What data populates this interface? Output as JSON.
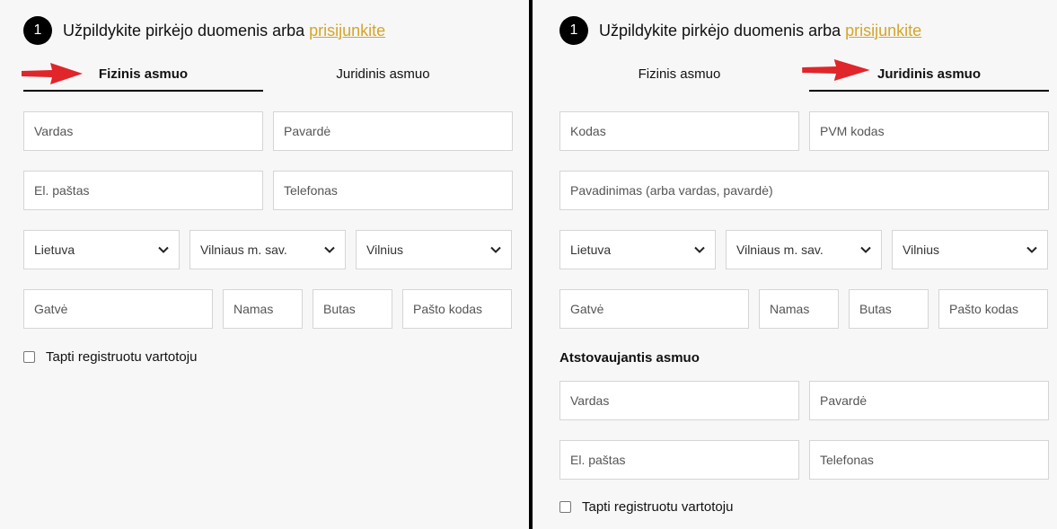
{
  "left": {
    "heading": {
      "step": "1",
      "text": "Užpildykite pirkėjo duomenis arba",
      "link": "prisijunkite"
    },
    "tabs": [
      {
        "label": "Fizinis asmuo",
        "active": true
      },
      {
        "label": "Juridinis asmuo",
        "active": false
      }
    ],
    "fields": {
      "first_name": "Vardas",
      "last_name": "Pavardė",
      "email": "El. paštas",
      "phone": "Telefonas",
      "country": "Lietuva",
      "municipality": "Vilniaus m. sav.",
      "city": "Vilnius",
      "street": "Gatvė",
      "house": "Namas",
      "apartment": "Butas",
      "postal_code": "Pašto kodas"
    },
    "register_label": "Tapti registruotu vartotoju"
  },
  "right": {
    "heading": {
      "step": "1",
      "text": "Užpildykite pirkėjo duomenis arba",
      "link": "prisijunkite"
    },
    "tabs": [
      {
        "label": "Fizinis asmuo",
        "active": false
      },
      {
        "label": "Juridinis asmuo",
        "active": true
      }
    ],
    "fields": {
      "company_code": "Kodas",
      "vat_code": "PVM kodas",
      "company_name": "Pavadinimas (arba vardas, pavardė)",
      "country": "Lietuva",
      "municipality": "Vilniaus m. sav.",
      "city": "Vilnius",
      "street": "Gatvė",
      "house": "Namas",
      "apartment": "Butas",
      "postal_code": "Pašto kodas"
    },
    "representative_title": "Atstovaujantis asmuo",
    "representative": {
      "first_name": "Vardas",
      "last_name": "Pavardė",
      "email": "El. paštas",
      "phone": "Telefonas"
    },
    "register_label": "Tapti registruotu vartotoju"
  },
  "colors": {
    "link": "#d4a52a",
    "arrow": "#e0262b",
    "divider": "#000000"
  },
  "icons": {
    "arrow": "red-arrow-icon",
    "dropdown": "chevron-down-icon"
  }
}
